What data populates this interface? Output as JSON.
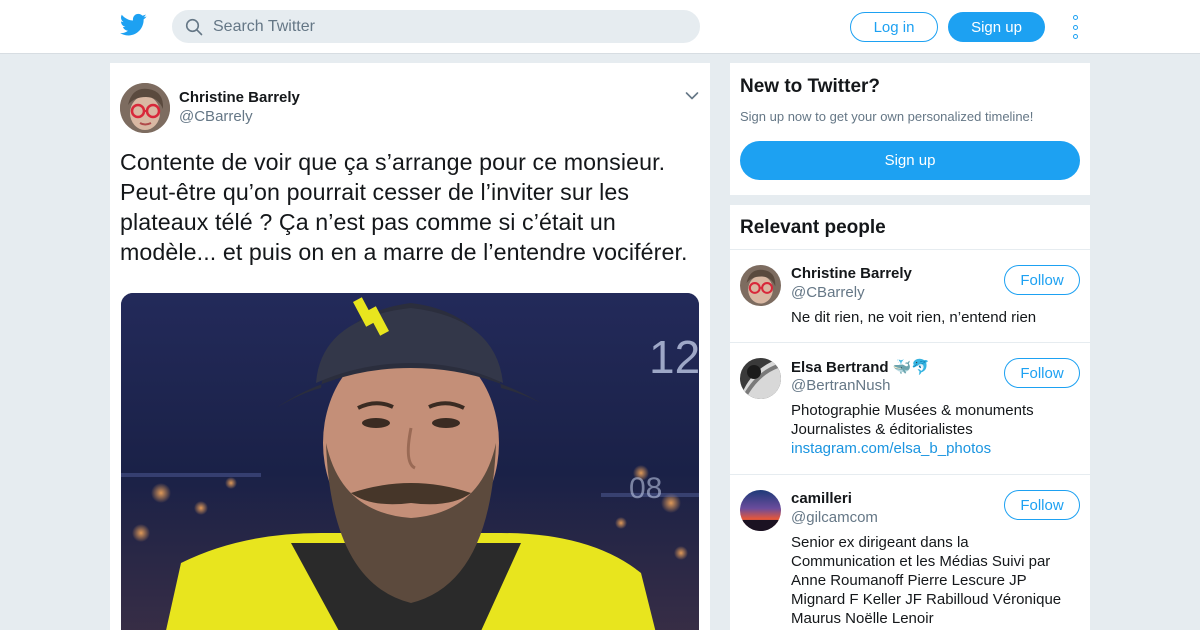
{
  "header": {
    "logo_icon": "twitter-bird-icon",
    "search_placeholder": "Search Twitter",
    "login_label": "Log in",
    "signup_label": "Sign up",
    "more_icon": "vertical-dots-icon",
    "accent_color": "#1da1f2"
  },
  "tweet": {
    "author_name": "Christine Barrely",
    "author_handle": "@CBarrely",
    "text": "Contente de voir que ça s’arrange pour ce monsieur. Peut-être qu’on pourrait cesser de l’inviter sur les plateaux télé ? Ça n’est pas comme si c’était un modèle... et puis on en a marre de l’entendre vociférer.",
    "media_overlay_numbers": [
      "12",
      "08"
    ]
  },
  "signup_card": {
    "title": "New to Twitter?",
    "subtitle": "Sign up now to get your own personalized timeline!",
    "button_label": "Sign up"
  },
  "relevant_people": {
    "title": "Relevant people",
    "people": [
      {
        "name": "Christine Barrely",
        "handle": "@CBarrely",
        "follow_label": "Follow",
        "bio": "Ne dit rien, ne voit rien, n’entend rien"
      },
      {
        "name": "Elsa Bertrand",
        "name_emoji": "🐳🐬",
        "handle": "@BertranNush",
        "follow_label": "Follow",
        "bio_line1": "Photographie Musées & monuments",
        "bio_line2": "Journalistes & éditorialistes",
        "bio_link": "instagram.com/elsa_b_photos"
      },
      {
        "name": "camilleri",
        "handle": "@gilcamcom",
        "follow_label": "Follow",
        "bio": "Senior ex dirigeant dans la Communication et les Médias Suivi par Anne Roumanoff Pierre Lescure JP Mignard F Keller JF Rabilloud Véronique Maurus Noëlle Lenoir"
      }
    ]
  }
}
